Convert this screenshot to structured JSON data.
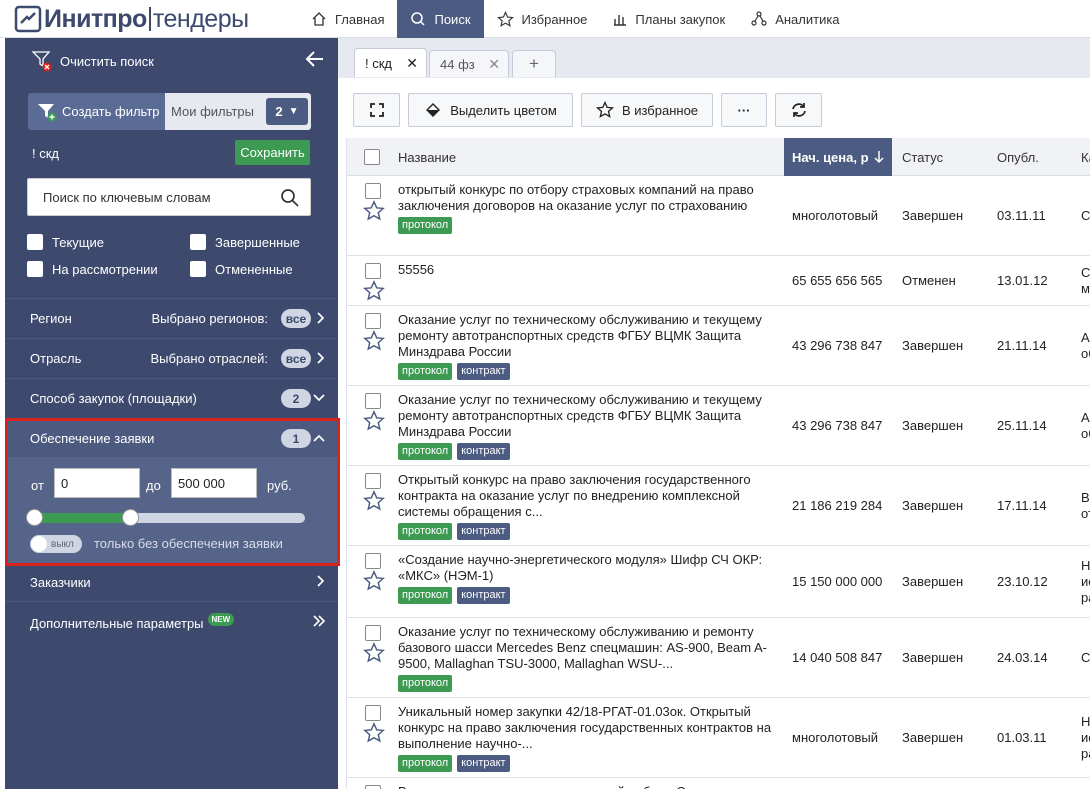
{
  "logo": {
    "part1": "Инитпро",
    "part2": "тендеры"
  },
  "nav": [
    {
      "label": "Главная",
      "icon": "home-icon"
    },
    {
      "label": "Поиск",
      "icon": "search-icon",
      "active": true
    },
    {
      "label": "Избранное",
      "icon": "star-icon"
    },
    {
      "label": "Планы закупок",
      "icon": "bar-chart-icon"
    },
    {
      "label": "Аналитика",
      "icon": "network-icon"
    }
  ],
  "sidebar": {
    "clear_label": "Очистить поиск",
    "create_filter": "Создать фильтр",
    "my_filters": "Мои фильтры",
    "my_filters_count": "2",
    "filter_name": "! скд",
    "save": "Сохранить",
    "search_placeholder": "Поиск по ключевым словам",
    "checkboxes": [
      "Текущие",
      "Завершенные",
      "На рассмотрении",
      "Отмененные"
    ],
    "sections": [
      {
        "title": "Регион",
        "value": "Выбрано регионов:",
        "pill": "все"
      },
      {
        "title": "Отрасль",
        "value": "Выбрано отраслей:",
        "pill": "все"
      },
      {
        "title": "Способ закупок (площадки)",
        "value": "",
        "pill": "2"
      }
    ],
    "guarantee": {
      "title": "Обеспечение заявки",
      "count": "1",
      "from_label": "от",
      "from_value": "0",
      "to_label": "до",
      "to_value": "500 000",
      "unit": "руб.",
      "slider_min_fraction": 0,
      "slider_max_fraction": 0.34,
      "toggle_label": "выкл",
      "toggle_text": "только без обеспечения заявки"
    },
    "customers": "Заказчики",
    "extra": "Дополнительные параметры",
    "new_badge": "NEW"
  },
  "tabs": [
    {
      "label": "! скд",
      "active": true
    },
    {
      "label": "44 фз",
      "active": false
    }
  ],
  "toolbar": {
    "color": "Выделить цветом",
    "favorite": "В избранное",
    "more": "···"
  },
  "table": {
    "headers": {
      "name": "Название",
      "price": "Нач. цена, р",
      "status": "Статус",
      "published": "Опубл.",
      "category": "Ка"
    },
    "rows": [
      {
        "name": "открытый конкурс по отбору страховых компаний на право заключения договоров на оказание услуг по страхованию",
        "tags": [
          "протокол"
        ],
        "price": "многолотовый",
        "status": "Завершен",
        "date": "03.11.11",
        "cat": "Ст"
      },
      {
        "name": "55556",
        "tags": [],
        "price": "65 655 656 565",
        "status": "Отменен",
        "date": "13.01.12",
        "cat": "Ст\nм"
      },
      {
        "name": "Оказание услуг по техническому обслуживанию и текущему ремонту автотранспортных средств ФГБУ ВЦМК Защита Минздрава России",
        "tags": [
          "протокол",
          "контракт"
        ],
        "price": "43 296 738 847",
        "status": "Завершен",
        "date": "21.11.14",
        "cat": "А\nоб"
      },
      {
        "name": "Оказание услуг по техническому обслуживанию и текущему ремонту автотранспортных средств ФГБУ ВЦМК Защита Минздрава России",
        "tags": [
          "протокол",
          "контракт"
        ],
        "price": "43 296 738 847",
        "status": "Завершен",
        "date": "25.11.14",
        "cat": "А\nоб"
      },
      {
        "name": "Открытый конкурс на право заключения государственного контракта на оказание услуг по внедрению комплексной системы обращения с...",
        "tags": [
          "протокол",
          "контракт"
        ],
        "price": "21 186 219 284",
        "status": "Завершен",
        "date": "17.11.14",
        "cat": "В\nот"
      },
      {
        "name": "«Создание научно-энергетического модуля» Шифр СЧ ОКР: «МКС» (НЭМ-1)",
        "tags": [
          "протокол",
          "контракт"
        ],
        "price": "15 150 000 000",
        "status": "Завершен",
        "date": "23.10.12",
        "cat": "Н\nис\nра"
      },
      {
        "name": "Оказание услуг по техническому обслуживанию и ремонту базового шасси Mercedes Benz спецмашин: AS-900, Beam A-9500, Mallaghan TSU-3000, Mallaghan WSU-...",
        "tags": [
          "протокол"
        ],
        "price": "14 040 508 847",
        "status": "Завершен",
        "date": "24.03.14",
        "cat": "Сп"
      },
      {
        "name": "Уникальный номер закупки 42/18-РГАТ-01.03ок. Открытый конкурс на право заключения государственных контрактов на выполнение научно-...",
        "tags": [
          "протокол",
          "контракт"
        ],
        "price": "многолотовый",
        "status": "Завершен",
        "date": "01.03.11",
        "cat": "Н\nис\nра"
      },
      {
        "name": "Выполнение опытно-конструкторской работы Создание",
        "tags": [],
        "price": "",
        "status": "",
        "date": "",
        "cat": "Н"
      }
    ]
  }
}
